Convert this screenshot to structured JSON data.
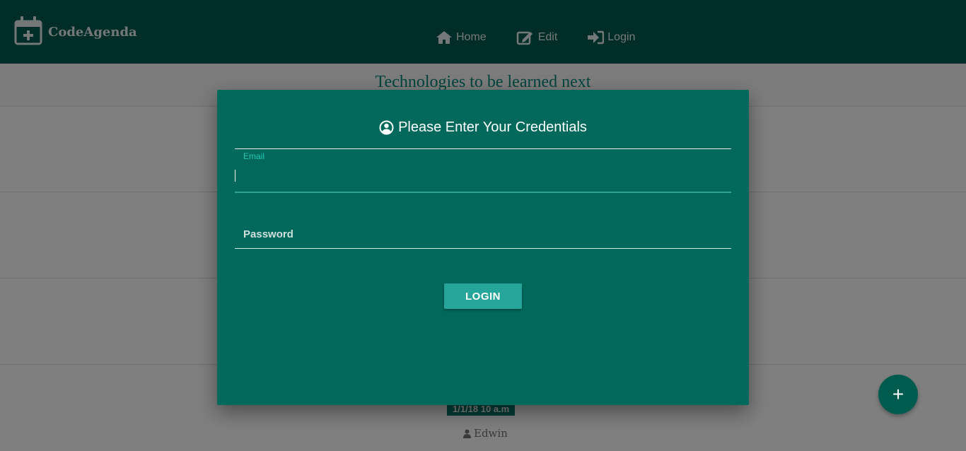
{
  "brand": {
    "name": "CodeAgenda",
    "icon": "calendar-plus-icon"
  },
  "nav": {
    "items": [
      {
        "label": "Home",
        "icon": "home-icon"
      },
      {
        "label": "Edit",
        "icon": "edit-icon"
      },
      {
        "label": "Login",
        "icon": "sign-in-icon"
      }
    ]
  },
  "page": {
    "title": "Technologies to be learned next",
    "entry": {
      "date": "1/1/18 10 a.m",
      "author": "Edwin",
      "author_icon": "user-icon"
    }
  },
  "modal": {
    "title": "Please Enter Your Credentials",
    "title_icon": "user-circle-icon",
    "email": {
      "label": "Email",
      "value": ""
    },
    "password": {
      "placeholder": "Password",
      "value": ""
    },
    "submit_label": "LOGIN"
  },
  "fab": {
    "label": "+",
    "icon": "plus-icon"
  },
  "colors": {
    "navbar": "#005b4f",
    "modal": "#00695c",
    "accent": "#26a69a",
    "title": "#00897b"
  }
}
